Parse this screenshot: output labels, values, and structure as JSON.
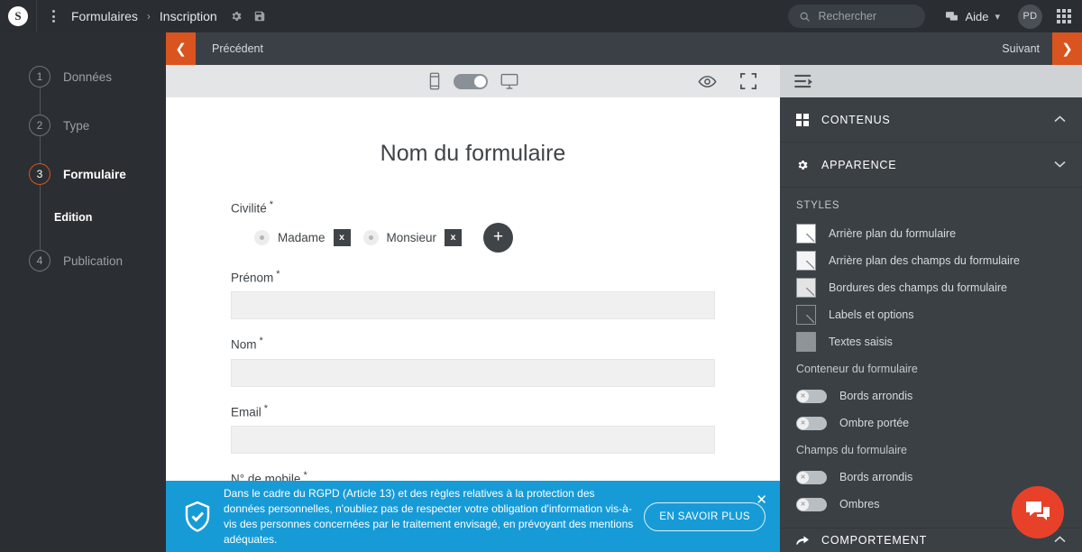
{
  "topbar": {
    "logo_letter": "S",
    "menu_icon": "kebab-menu-icon",
    "breadcrumb": [
      {
        "label": "Formulaires"
      },
      {
        "label": "Inscription"
      }
    ],
    "breadcrumb_separator": "›",
    "settings_icon": "gear-icon",
    "save_icon": "floppy-disk-icon",
    "search": {
      "placeholder": "Rechercher",
      "value": "",
      "icon": "search-icon"
    },
    "help": {
      "label": "Aide",
      "icon": "chat-help-icon",
      "chevron": "⌄"
    },
    "avatar_initials": "PD",
    "apps_icon": "apps-grid-icon"
  },
  "stepper": {
    "steps": [
      {
        "number": "1",
        "label": "Données",
        "active": false
      },
      {
        "number": "2",
        "label": "Type",
        "active": false
      },
      {
        "number": "3",
        "label": "Formulaire",
        "active": true
      },
      {
        "number": "4",
        "label": "Publication",
        "active": false
      }
    ],
    "substep": {
      "label": "Edition"
    }
  },
  "navbar": {
    "prev_label": "Précédent",
    "prev_icon": "chevron-left-icon",
    "next_label": "Suivant",
    "next_icon": "chevron-right-icon"
  },
  "preview_toolbar": {
    "mobile_icon": "mobile-device-icon",
    "desktop_icon": "desktop-device-icon",
    "device_toggle_state": "desktop",
    "preview_icon": "eye-icon",
    "fullscreen_icon": "fullscreen-icon",
    "panel_toggle_icon": "panel-collapse-icon"
  },
  "form": {
    "title": "Nom du formulaire",
    "required_mark": "*",
    "civility": {
      "label": "Civilité",
      "options": [
        {
          "label": "Madame",
          "delete_label": "x"
        },
        {
          "label": "Monsieur",
          "delete_label": "x"
        }
      ],
      "add_label": "+"
    },
    "fields": [
      {
        "label": "Prénom",
        "value": ""
      },
      {
        "label": "Nom",
        "value": ""
      },
      {
        "label": "Email",
        "value": ""
      },
      {
        "label": "N° de mobile",
        "value": ""
      }
    ]
  },
  "rgpd_banner": {
    "shield_icon": "shield-check-icon",
    "message": "Dans le cadre du RGPD (Article 13) et des règles relatives à la protection des données personnelles, n'oubliez pas de respecter votre obligation d'information vis-à-vis des personnes concernées par le traitement envisagé, en prévoyant des mentions adéquates.",
    "button_label": "EN SAVOIR PLUS",
    "close_label": "✕",
    "background_color": "#179bd7"
  },
  "right_panel": {
    "sections": [
      {
        "title": "CONTENUS",
        "icon": "grid-squares-icon",
        "chevron": "⌃",
        "expanded": false
      },
      {
        "title": "APPARENCE",
        "icon": "gear-icon",
        "chevron": "⌄",
        "expanded": true
      }
    ],
    "styles_group_title": "STYLES",
    "style_rows": [
      {
        "label": "Arrière plan du formulaire",
        "color": "#ffffff"
      },
      {
        "label": "Arrière plan des champs du formulaire",
        "color": "#f4f4f4"
      },
      {
        "label": "Bordures des champs du formulaire",
        "color": "#e3e3e3"
      },
      {
        "label": "Labels et options",
        "color": "#3f4448"
      },
      {
        "label": "Textes saisis",
        "color": "#8f9499"
      }
    ],
    "container_group_title": "Conteneur du formulaire",
    "container_toggles": [
      {
        "label": "Bords arrondis",
        "on": false
      },
      {
        "label": "Ombre portée",
        "on": false
      }
    ],
    "fields_group_title": "Champs du formulaire",
    "fields_toggles": [
      {
        "label": "Bords arrondis",
        "on": false
      },
      {
        "label": "Ombres",
        "on": false
      }
    ],
    "behavior_section": {
      "title": "COMPORTEMENT",
      "icon": "arrow-curve-icon",
      "chevron": "⌃"
    }
  },
  "chat_fab": {
    "icon": "chat-bubble-icon",
    "color": "#e8412a"
  },
  "accent_color": "#d9541e"
}
